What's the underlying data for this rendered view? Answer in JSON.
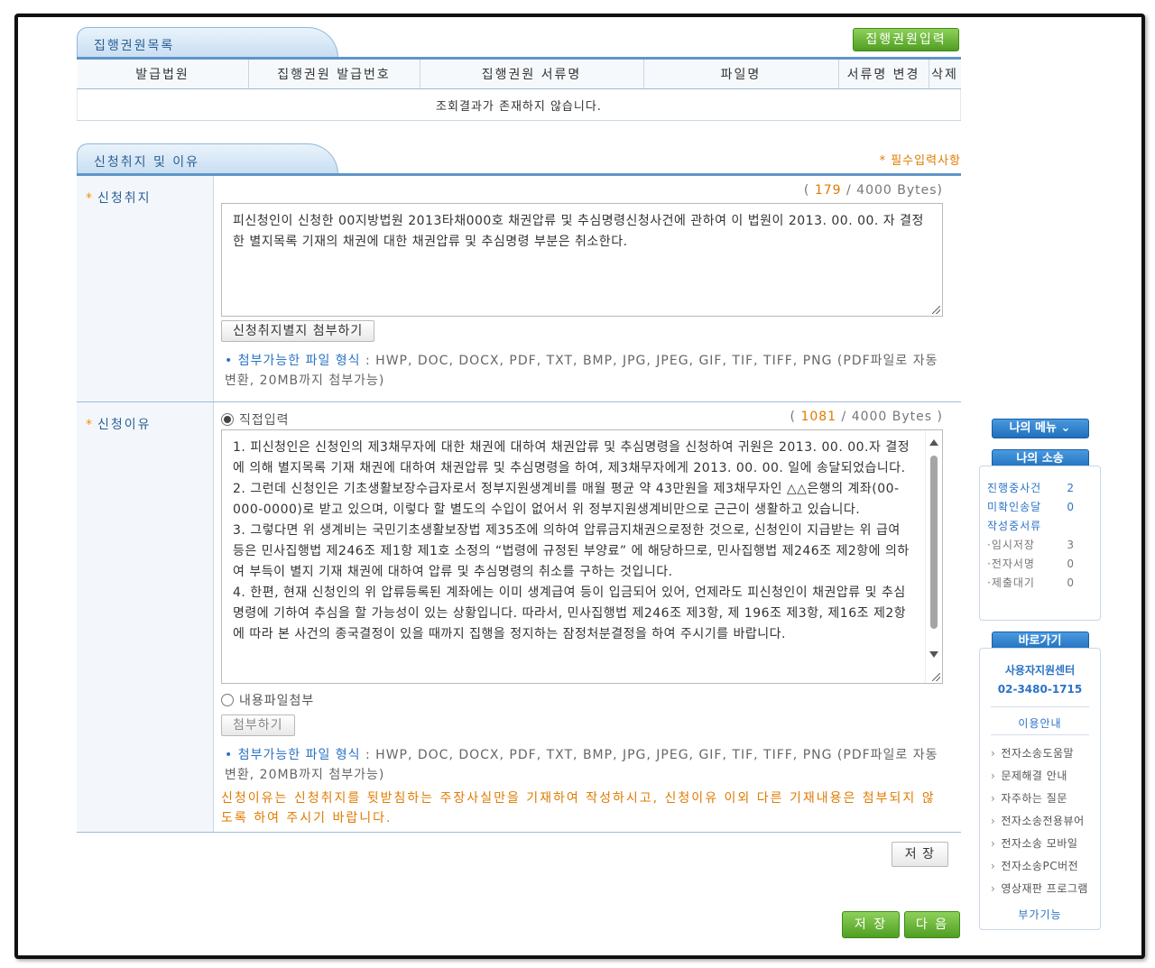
{
  "exec_list": {
    "title": "집행권원목록",
    "input_button": "집행권원입력",
    "columns": [
      "발급법원",
      "집행권원 발급번호",
      "집행권원 서류명",
      "파일명",
      "서류명 변경",
      "삭제"
    ],
    "empty_message": "조회결과가 존재하지 않습니다."
  },
  "withdraw": {
    "title": "신청취지 및 이유",
    "required_note": "* 필수입력사항",
    "purpose": {
      "label": "신청취지",
      "byte_count": "179",
      "byte_max": "/ 4000 Bytes)",
      "byte_open": "(",
      "text": "피신청인이 신청한 00지방법원 2013타채000호 채권압류 및 추심명령신청사건에 관하여 이 법원이 2013. 00. 00. 자 결정한 별지목록 기재의 채권에 대한 채권압류 및 추심명령 부분은 취소한다.",
      "attach_button": "신청취지별지 첨부하기"
    },
    "reason": {
      "label": "신청이유",
      "direct_input_label": "직접입력",
      "byte_open": "(",
      "byte_count": "1081",
      "byte_max": "/ 4000 Bytes )",
      "paragraphs": [
        "1. 피신청인은 신청인의 제3채무자에 대한 채권에 대하여 채권압류 및 추심명령을 신청하여 귀원은 2013. 00. 00.자 결정에 의해 별지목록 기재 채권에 대하여 채권압류 및 추심명령을 하여, 제3채무자에게 2013. 00. 00. 일에 송달되었습니다.",
        "2. 그런데 신청인은 기초생활보장수급자로서 정부지원생계비를 매월 평균 약 43만원을 제3채무자인 △△은행의 계좌(00-000-0000)로 받고 있으며, 이렇다 할 별도의 수입이 없어서 위 정부지원생계비만으로 근근이 생활하고 있습니다.",
        "3. 그렇다면 위 생계비는 국민기초생활보장법 제35조에 의하여 압류금지채권으로정한 것으로, 신청인이 지급받는 위 급여 등은 민사집행법 제246조 제1항 제1호 소정의 “법령에 규정된 부양료” 에 해당하므로, 민사집행법 제246조 제2항에 의하여 부득이 별지 기재 채권에 대하여 압류 및 추심명령의 취소를 구하는 것입니다.",
        "4. 한편, 현재 신청인의 위 압류등록된 계좌에는 이미 생계급여 등이 입금되어 있어, 언제라도 피신청인이 채권압류 및 추심명령에 기하여 추심을 할 가능성이 있는 상황입니다. 따라서, 민사집행법 제246조 제3항, 제 196조 제3항, 제16조 제2항에 따라 본 사건의 종국결정이 있을 때까지 집행을 정지하는 잠정처분결정을 하여 주시기를 바랍니다."
      ],
      "file_attach_label": "내용파일첨부",
      "attach_button": "첨부하기",
      "warning": "신청이유는 신청취지를 뒷받침하는 주장사실만을 기재하여 작성하시고, 신청이유 이외 다른 기재내용은 첨부되지 않도록 하여 주시기 바랍니다."
    },
    "filetype_label": "첨부가능한 파일 형식",
    "filetype_list": ": HWP, DOC, DOCX, PDF, TXT, BMP, JPG, JPEG, GIF, TIF, TIFF, PNG (PDF파일로 자동변환, 20MB까지 첨부가능)",
    "save_button": "저 장"
  },
  "footer": {
    "save_button": "저 장",
    "next_button": "다 음"
  },
  "sidebar": {
    "my_menu": "나의 메뉴",
    "my_case": "나의 소송",
    "case_items": [
      {
        "label": "진행중사건",
        "count": "2"
      },
      {
        "label": "미확인송달",
        "count": "0"
      },
      {
        "label": "작성중서류",
        "count": ""
      },
      {
        "label": "·임시저장",
        "count": "3"
      },
      {
        "label": "·전자서명",
        "count": "0"
      },
      {
        "label": "·제출대기",
        "count": "0"
      }
    ],
    "shortcut": "바로가기",
    "support_center": "사용자지원센터",
    "support_phone": "02-3480-1715",
    "guide_title": "이용안내",
    "guide_links": [
      "전자소송도움말",
      "문제해결 안내",
      "자주하는 질문",
      "전자소송전용뷰어",
      "전자소송 모바일",
      "전자소송PC버전",
      "영상재판 프로그램"
    ],
    "extra_title": "부가기능"
  }
}
